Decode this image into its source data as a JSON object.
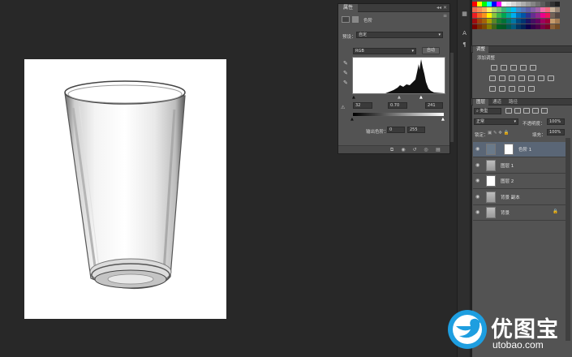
{
  "properties_panel": {
    "tab_label": "属性",
    "header_title": "色阶",
    "preset_label": "预设：",
    "preset_value": "自定",
    "channel_value": "RGB",
    "auto_button": "自动",
    "input_black": "32",
    "input_gamma": "0.70",
    "input_white": "241",
    "output_label": "输出色阶：",
    "output_black": "0",
    "output_white": "255"
  },
  "adjustments_panel": {
    "tab_label": "调整",
    "add_label": "添加调整"
  },
  "layers_panel": {
    "tabs": [
      "图层",
      "通道",
      "路径"
    ],
    "filter_kind": "类型",
    "blend_mode": "正常",
    "opacity_label": "不透明度：",
    "opacity_value": "100%",
    "lock_label": "锁定：",
    "fill_label": "填充：",
    "fill_value": "100%",
    "layers": [
      {
        "name": "色阶 1",
        "selected": true,
        "thumb": "levels-adjustment"
      },
      {
        "name": "图层 1",
        "selected": false,
        "thumb": "glass"
      },
      {
        "name": "图层 2",
        "selected": false,
        "thumb": "white"
      },
      {
        "name": "背景 副本",
        "selected": false,
        "thumb": "glass"
      },
      {
        "name": "背景",
        "selected": false,
        "thumb": "glass",
        "locked": true
      }
    ]
  },
  "watermark": {
    "title": "优图宝",
    "url": "utobao.com"
  },
  "colors": {
    "workspace": "#282828",
    "panel": "#535353",
    "selected_layer": "#5a6676",
    "watermark_blue": "#1e9ee0"
  }
}
